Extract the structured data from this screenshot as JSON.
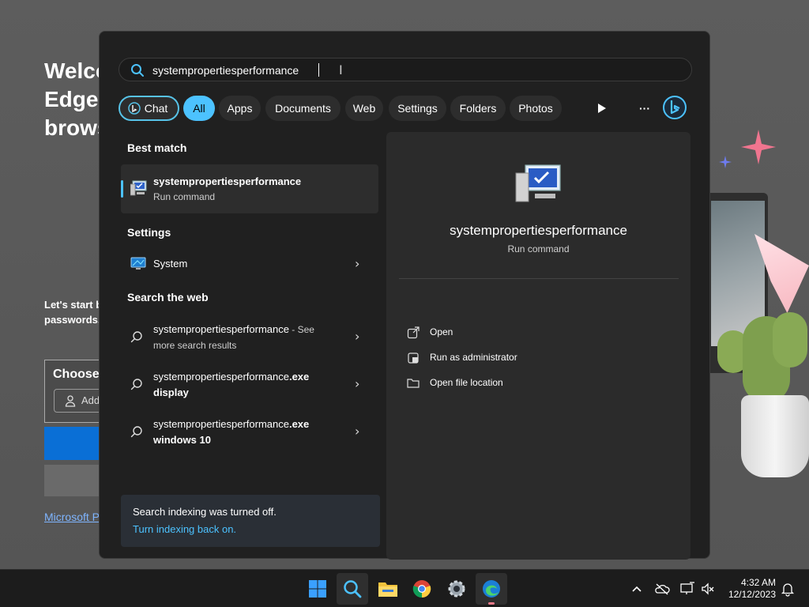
{
  "background": {
    "welcome_lines": "Welco\nEdge,\nbrows",
    "sub_lines": "Let's start b\npasswords,",
    "choose_title": "Choose",
    "add_label": "Add",
    "link_text": "Microsoft P"
  },
  "search": {
    "value": "systempropertiesperformance"
  },
  "filters": {
    "chat": "Chat",
    "all": "All",
    "apps": "Apps",
    "documents": "Documents",
    "web": "Web",
    "settings": "Settings",
    "folders": "Folders",
    "photos": "Photos",
    "more": "···"
  },
  "results": {
    "best_match_heading": "Best match",
    "best_match": {
      "title": "systempropertiesperformance",
      "subtitle": "Run command"
    },
    "settings_heading": "Settings",
    "settings_item": "System",
    "web_heading": "Search the web",
    "web_items": [
      {
        "query": "systempropertiesperformance",
        "suffix": " - See",
        "line2": "more search results"
      },
      {
        "query": "systempropertiesperformance",
        "bold": ".exe",
        "line2": "display"
      },
      {
        "query": "systempropertiesperformance",
        "bold": ".exe",
        "line2": "windows 10"
      }
    ]
  },
  "notice": {
    "text": "Search indexing was turned off.",
    "link": "Turn indexing back on."
  },
  "preview": {
    "title": "systempropertiesperformance",
    "subtitle": "Run command",
    "actions": [
      "Open",
      "Run as administrator",
      "Open file location"
    ]
  },
  "clock": {
    "time": "4:32 AM",
    "date": "12/12/2023"
  },
  "colors": {
    "accent": "#4cc2ff",
    "panel": "#202020",
    "preview_pane": "#2b2b2b"
  }
}
